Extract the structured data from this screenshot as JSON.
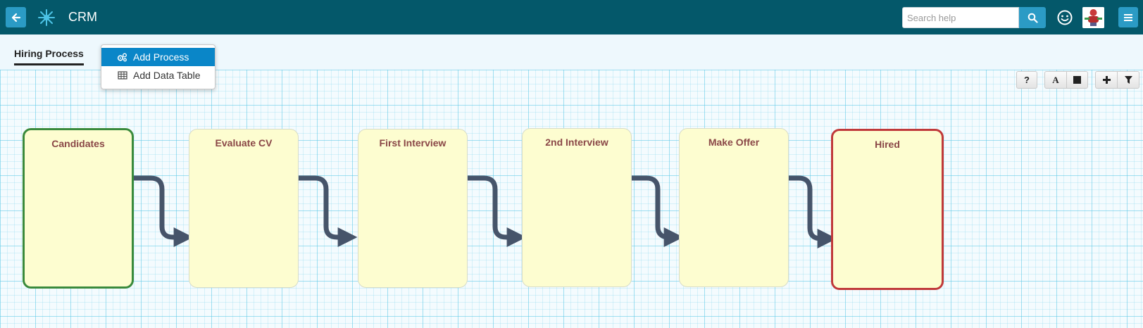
{
  "app": {
    "title": "CRM"
  },
  "search": {
    "placeholder": "Search help",
    "value": ""
  },
  "tabs": [
    {
      "label": "Hiring Process"
    }
  ],
  "dropdown": {
    "items": [
      {
        "label": "Add Process",
        "icon": "gears-icon",
        "highlighted": true
      },
      {
        "label": "Add Data Table",
        "icon": "table-icon",
        "highlighted": false
      }
    ]
  },
  "toolbar": {
    "help_label": "?",
    "font_label": "A",
    "buttons": [
      "help-icon",
      "font-icon",
      "square-icon",
      "plus-icon",
      "filter-icon"
    ]
  },
  "process": {
    "nodes": [
      {
        "label": "Candidates",
        "status": "start"
      },
      {
        "label": "Evaluate CV",
        "status": "normal"
      },
      {
        "label": "First Interview",
        "status": "normal"
      },
      {
        "label": "2nd Interview",
        "status": "normal"
      },
      {
        "label": "Make Offer",
        "status": "normal"
      },
      {
        "label": "Hired",
        "status": "end"
      }
    ]
  },
  "colors": {
    "header": "#04586a",
    "accent": "#2b9bc5",
    "node_fill": "#fdfdd0",
    "node_label": "#8a4747",
    "start_border": "#3a8a3c",
    "end_border": "#c0393a",
    "connector": "#46546a"
  }
}
